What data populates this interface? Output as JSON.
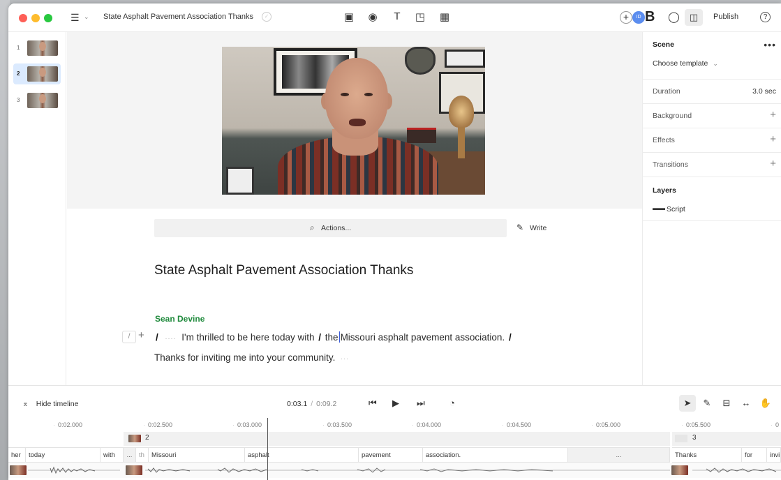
{
  "header": {
    "doc_title": "State Asphalt Pavement Association Thanks",
    "avatar_initials": "ID",
    "avatar_letter": "B",
    "publish_label": "Publish",
    "help_label": "?"
  },
  "thumbnails": [
    {
      "number": "1",
      "selected": false
    },
    {
      "number": "2",
      "selected": true
    },
    {
      "number": "3",
      "selected": false
    }
  ],
  "editor": {
    "actions_label": "Actions...",
    "write_label": "Write",
    "script_title": "State Asphalt Pavement Association Thanks",
    "speaker": "Sean Devine",
    "line1_a": "I'm thrilled to be here today with",
    "line1_b": "the",
    "line1_c": "Missouri asphalt pavement association.",
    "line2": "Thanks for inviting me into your community.",
    "cut_mark": "/",
    "pause_mark": "····",
    "pause_mark_short": "···"
  },
  "right_panel": {
    "scene_label": "Scene",
    "choose_template": "Choose template",
    "duration_label": "Duration",
    "duration_value": "3.0 sec",
    "background_label": "Background",
    "effects_label": "Effects",
    "transitions_label": "Transitions",
    "layers_label": "Layers",
    "layer_script": "Script"
  },
  "timeline": {
    "hide_label": "Hide timeline",
    "current_time": "0:03.1",
    "separator": "/",
    "total_time": "0:09.2",
    "ruler": [
      "0:02.000",
      "0:02.500",
      "0:03.000",
      "0:03.500",
      "0:04.000",
      "0:04.500",
      "0:05.000",
      "0:05.500",
      "0"
    ],
    "scene2_label": "2",
    "scene3_label": "3",
    "words": [
      "her",
      "today",
      "with",
      "...",
      "th",
      "Missouri",
      "asphalt",
      "pavement",
      "association.",
      "...",
      "Thanks",
      "for",
      "invi"
    ]
  },
  "colors": {
    "speaker": "#1f8a3c",
    "cursor": "#3a5bd9",
    "selected_thumb": "#dbeafe"
  }
}
